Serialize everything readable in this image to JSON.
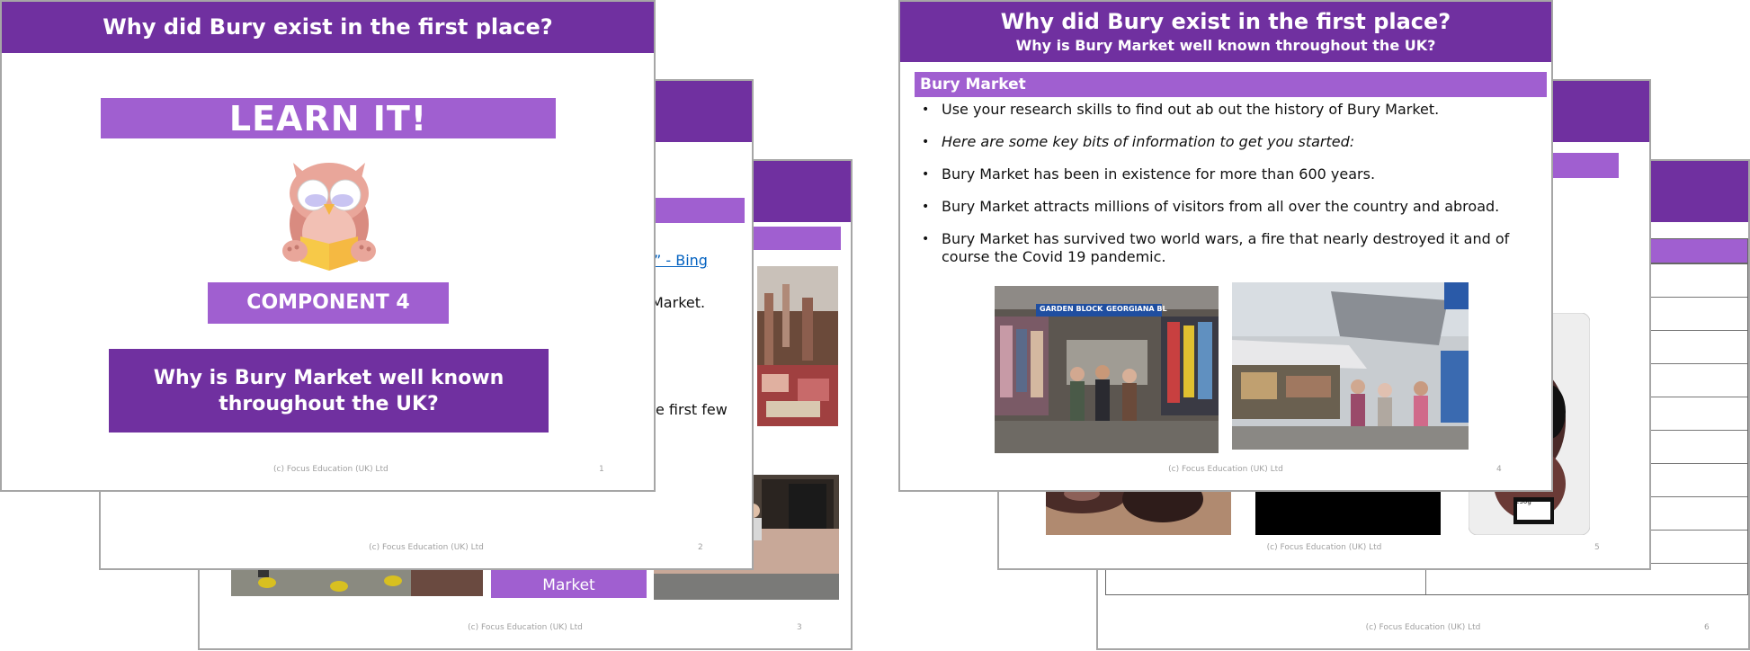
{
  "slide1": {
    "title": "Why did Bury exist in the first place?",
    "learn_it": "LEARN IT!",
    "mascot_icon": "owl-reading-book-icon",
    "component": "COMPONENT 4",
    "question": "Why is Bury Market well known throughout the UK?",
    "footer": "(c) Focus Education (UK) Ltd",
    "page": "1"
  },
  "slide2": {
    "link_fragment": "” - Bing",
    "text_fragment_1": "Market.",
    "text_fragment_2": "e first few",
    "footer": "(c) Focus Education (UK) Ltd",
    "page": "2"
  },
  "slide3": {
    "button_label": "Market",
    "footer": "(c) Focus Education (UK) Ltd",
    "page": "3"
  },
  "slide4": {
    "title": "Why did Bury exist in the first place?",
    "subtitle": "Why is Bury Market well known throughout the UK?",
    "section": "Bury Market",
    "bullets": [
      "Use your research skills to find out ab out the history of Bury Market.",
      "Here are some key bits of information to get you started:",
      "Bury Market has been in existence for more than 600 years.",
      "Bury Market attracts millions of visitors from all over the country and abroad.",
      "Bury Market has survived two world wars, a fire that nearly destroyed it and of course the Covid 19 pandemic."
    ],
    "photo_sign_1": "GARDEN BLOCK",
    "photo_sign_2": "GEORGIANA BL",
    "footer": "(c) Focus Education (UK) Ltd",
    "page": "4"
  },
  "slide5": {
    "package_label": "230g",
    "footer": "(c) Focus Education (UK) Ltd",
    "page": "5"
  },
  "slide6": {
    "footer": "(c) Focus Education (UK) Ltd",
    "page": "6"
  },
  "colors": {
    "header_purple": "#7030a0",
    "bar_lilac": "#a05fd0",
    "link_blue": "#0563c1"
  }
}
